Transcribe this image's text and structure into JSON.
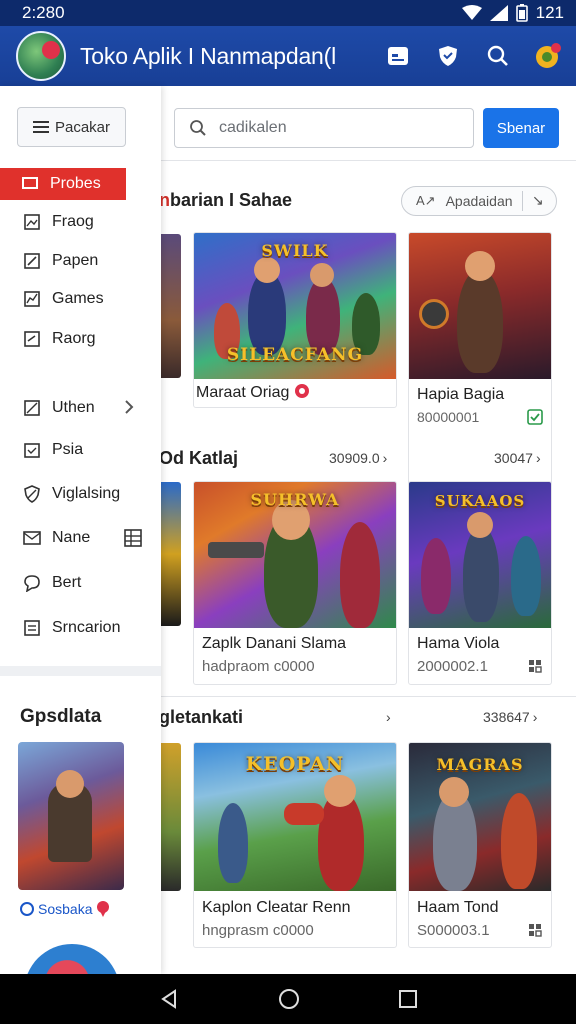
{
  "status_bar": {
    "time": "2:280",
    "right_text": "121"
  },
  "app_bar": {
    "title": "Toko Aplik I Nanmapdan(l"
  },
  "drawer": {
    "menu_label": "Pacakar",
    "items": [
      {
        "label": "Probes",
        "icon": "monitor-icon",
        "active": true
      },
      {
        "label": "Fraog",
        "icon": "image-icon"
      },
      {
        "label": "Papen",
        "icon": "edit-icon"
      },
      {
        "label": "Games",
        "icon": "chart-icon"
      },
      {
        "label": "Raorg",
        "icon": "note-icon"
      },
      {
        "label": "Uthen",
        "icon": "box-icon"
      },
      {
        "label": "Psia",
        "icon": "calendar-icon"
      },
      {
        "label": "Viglalsing",
        "icon": "shield-check-icon"
      },
      {
        "label": "Nane",
        "icon": "mail-check-icon"
      },
      {
        "label": "Bert",
        "icon": "chat-icon"
      },
      {
        "label": "Srncarion",
        "icon": "sheet-icon"
      }
    ],
    "featured_heading": "Gpsdlata",
    "featured_label": "Sosbaka"
  },
  "main": {
    "search": {
      "placeholder": "cadikalen",
      "button_label": "Sbenar"
    },
    "sections": [
      {
        "title_prefix": "n",
        "title_rest": "barian I Sahae",
        "filter_label": "Apadaidan",
        "cards": [
          {
            "name": "Maraat Oriag",
            "sub": "",
            "art_title_top": "SWILK",
            "art_title_bottom": "SILEACFANG"
          },
          {
            "name": "Hapia Bagia",
            "sub": "80000001",
            "art_title_top": "",
            "art_title_bottom": ""
          }
        ]
      },
      {
        "title": "Od Katlaj",
        "link_left": "30909.0",
        "link_right": "30047",
        "cards": [
          {
            "name": "Zaplk Danani Slama",
            "sub": "hadpraom c0000",
            "art_title_top": "SUHRWA",
            "art_title_bottom": ""
          },
          {
            "name": "Hama Viola",
            "sub": "2000002.1",
            "art_title_top": "SUKAAOS",
            "art_title_bottom": ""
          }
        ]
      },
      {
        "title": "gletankati",
        "link_right": "338647",
        "cards": [
          {
            "name": "Kaplon Cleatar Renn",
            "sub": "hngprasm c0000",
            "art_title_top": "KEOPAN",
            "art_title_bottom": ""
          },
          {
            "name": "Haam Tond",
            "sub": "S000003.1",
            "art_title_top": "MAGRAS",
            "art_title_bottom": ""
          }
        ]
      }
    ]
  },
  "colors": {
    "app_bar": "#1e4aa8",
    "accent_red": "#e0312c",
    "primary_blue": "#1a73e8"
  }
}
